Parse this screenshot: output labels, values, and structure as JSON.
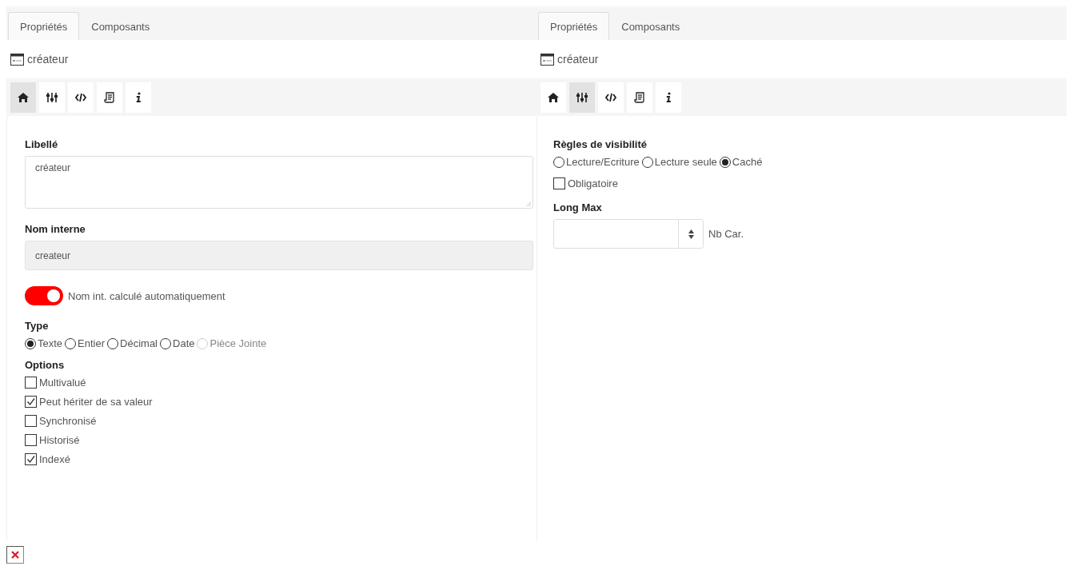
{
  "panels": [
    {
      "tabs": [
        {
          "label": "Propriétés",
          "selected": true
        },
        {
          "label": "Composants",
          "selected": false
        }
      ],
      "header": {
        "title": "créateur"
      },
      "toolbar": [
        {
          "kind": "home",
          "selected": true
        },
        {
          "kind": "sliders",
          "selected": false
        },
        {
          "kind": "code",
          "selected": false
        },
        {
          "kind": "script",
          "selected": false
        },
        {
          "kind": "info",
          "selected": false
        }
      ],
      "sections": [
        {
          "kind": "textarea",
          "label": "Libellé",
          "value": "créateur"
        },
        {
          "kind": "input",
          "label": "Nom interne",
          "value": "createur",
          "disabled": true
        },
        {
          "kind": "toggle",
          "text": "Nom int. calculé automatiquement",
          "on": true
        },
        {
          "kind": "radios",
          "label": "Type",
          "options": [
            {
              "text": "Texte",
              "selected": true,
              "disabled": false
            },
            {
              "text": "Entier",
              "selected": false,
              "disabled": false
            },
            {
              "text": "Décimal",
              "selected": false,
              "disabled": false
            },
            {
              "text": "Date",
              "selected": false,
              "disabled": false
            },
            {
              "text": "Pièce Jointe",
              "selected": false,
              "disabled": true
            }
          ]
        },
        {
          "kind": "checkboxes",
          "label": "Options",
          "options": [
            {
              "text": "Multivalué",
              "checked": false
            },
            {
              "text": "Peut hériter de sa valeur",
              "checked": true
            },
            {
              "text": "Synchronisé",
              "checked": false
            },
            {
              "text": "Historisé",
              "checked": false
            },
            {
              "text": "Indexé",
              "checked": true
            }
          ]
        }
      ]
    },
    {
      "tabs": [
        {
          "label": "Propriétés",
          "selected": true
        },
        {
          "label": "Composants",
          "selected": false
        }
      ],
      "header": {
        "title": "créateur"
      },
      "toolbar": [
        {
          "kind": "home",
          "selected": false
        },
        {
          "kind": "sliders",
          "selected": true
        },
        {
          "kind": "code",
          "selected": false
        },
        {
          "kind": "script",
          "selected": false
        },
        {
          "kind": "info",
          "selected": false
        }
      ],
      "sections": [
        {
          "kind": "radios",
          "label": "Règles de visibilité",
          "options": [
            {
              "text": "Lecture/Ecriture",
              "selected": false,
              "disabled": false
            },
            {
              "text": "Lecture seule",
              "selected": false,
              "disabled": false
            },
            {
              "text": "Caché",
              "selected": true,
              "disabled": false
            }
          ]
        },
        {
          "kind": "checkboxes",
          "options": [
            {
              "text": "Obligatoire",
              "checked": false
            }
          ]
        },
        {
          "kind": "number",
          "label": "Long Max",
          "unit": "Nb Car."
        }
      ]
    }
  ],
  "footer": {
    "broken_image": true
  }
}
